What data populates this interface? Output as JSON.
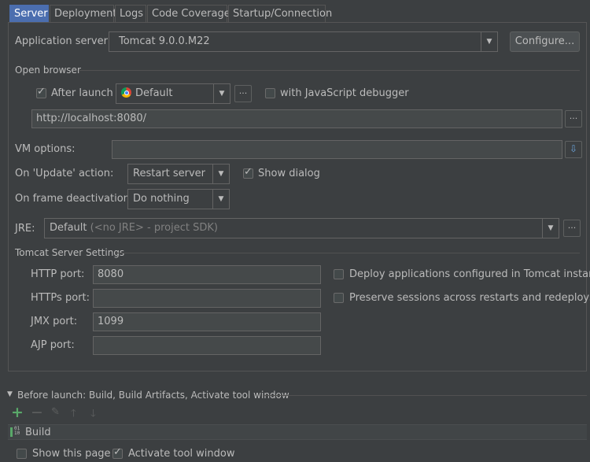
{
  "tabs": [
    {
      "label": "Server",
      "active": true
    },
    {
      "label": "Deployment"
    },
    {
      "label": "Logs"
    },
    {
      "label": "Code Coverage"
    },
    {
      "label": "Startup/Connection"
    }
  ],
  "app_server": {
    "label": "Application server:",
    "value": "Tomcat 9.0.0.M22",
    "configure": "Configure..."
  },
  "open_browser": {
    "title": "Open browser",
    "after_launch": "After launch",
    "browser": "Default",
    "more": "...",
    "js_debugger": "with JavaScript debugger",
    "url": "http://localhost:8080/"
  },
  "vm_options": {
    "label": "VM options:",
    "value": ""
  },
  "on_update": {
    "label": "On 'Update' action:",
    "value": "Restart server",
    "show_dialog": "Show dialog"
  },
  "on_frame": {
    "label": "On frame deactivation:",
    "value": "Do nothing"
  },
  "jre": {
    "label": "JRE:",
    "value": "Default",
    "hint": "(<no JRE> - project SDK)"
  },
  "tomcat": {
    "title": "Tomcat Server Settings",
    "http_label": "HTTP port:",
    "http_value": "8080",
    "https_label": "HTTPs port:",
    "https_value": "",
    "jmx_label": "JMX port:",
    "jmx_value": "1099",
    "ajp_label": "AJP port:",
    "ajp_value": "",
    "deploy": "Deploy applications configured in Tomcat instance",
    "preserve": "Preserve sessions across restarts and redeploys"
  },
  "before_launch": {
    "title": "Before launch: Build, Build Artifacts, Activate tool window",
    "item": "Build",
    "item_icon_text": "01\n10"
  },
  "footer": {
    "show_page": "Show this page",
    "activate": "Activate tool window"
  },
  "colors": {
    "background": "#3c3f41",
    "selected_tab": "#4b6eaf",
    "add_green": "#59a869"
  }
}
